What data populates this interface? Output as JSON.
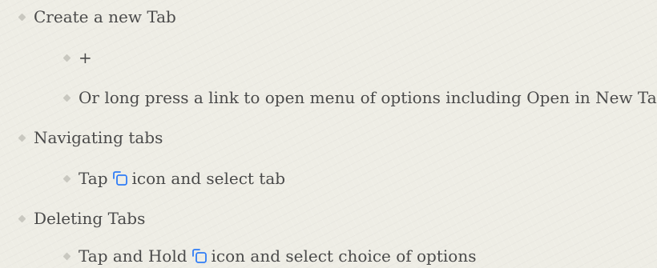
{
  "items": [
    {
      "text": "Create a new Tab"
    },
    {
      "text": "+"
    },
    {
      "text": "Or long press a link to open menu of options including Open in New Tab"
    },
    {
      "text": "Navigating tabs"
    },
    {
      "pre": "Tap",
      "post": "icon and select tab"
    },
    {
      "text": "Deleting Tabs"
    },
    {
      "pre": "Tap and Hold",
      "post": "icon and select choice of options"
    }
  ],
  "icons": {
    "tabs_icon": "tabs-icon",
    "bullet": "diamond-bullet"
  },
  "colors": {
    "background": "#eeede5",
    "text": "#4a4a4a",
    "icon": "#2f7cf6",
    "bullet": "#c9c8c0"
  }
}
